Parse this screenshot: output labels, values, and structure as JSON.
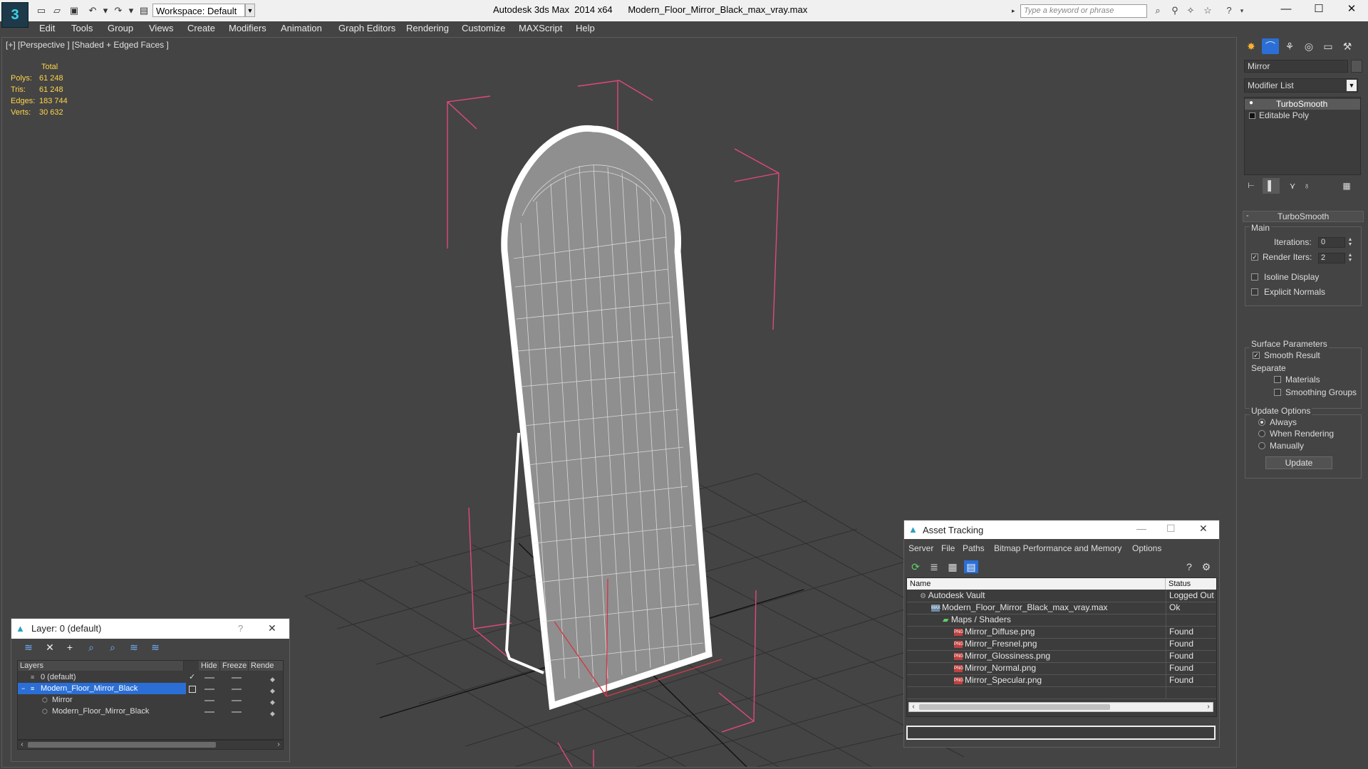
{
  "titlebar": {
    "app_title": "Autodesk 3ds Max  2014 x64",
    "file_title": "Modern_Floor_Mirror_Black_max_vray.max",
    "workspace": "Workspace: Default",
    "search_placeholder": "Type a keyword or phrase"
  },
  "menu": [
    "Edit",
    "Tools",
    "Group",
    "Views",
    "Create",
    "Modifiers",
    "Animation",
    "Graph Editors",
    "Rendering",
    "Customize",
    "MAXScript",
    "Help"
  ],
  "viewport": {
    "label": "[+] [Perspective ] [Shaded + Edged Faces ]",
    "stats": {
      "header": "Total",
      "polys_label": "Polys:",
      "polys": "61 248",
      "tris_label": "Tris:",
      "tris": "61 248",
      "edges_label": "Edges:",
      "edges": "183 744",
      "verts_label": "Verts:",
      "verts": "30 632"
    }
  },
  "command_panel": {
    "object_name": "Mirror",
    "modifier_list": "Modifier List",
    "stack": [
      "TurboSmooth",
      "Editable Poly"
    ],
    "rollout_title": "TurboSmooth",
    "main_label": "Main",
    "iterations_label": "Iterations:",
    "iterations": "0",
    "render_iters_label": "Render Iters:",
    "render_iters": "2",
    "render_iters_checked": true,
    "isoline_label": "Isoline Display",
    "explicit_normals_label": "Explicit Normals",
    "surface_label": "Surface Parameters",
    "smooth_result_label": "Smooth Result",
    "separate_label": "Separate",
    "materials_label": "Materials",
    "smoothing_groups_label": "Smoothing Groups",
    "update_options_label": "Update Options",
    "always_label": "Always",
    "when_rendering_label": "When Rendering",
    "manually_label": "Manually",
    "update_button": "Update"
  },
  "layer_dialog": {
    "title": "Layer: 0 (default)",
    "help": "?",
    "columns": [
      "Layers",
      "Hide",
      "Freeze",
      "Rende"
    ],
    "rows": [
      "0 (default)",
      "Modern_Floor_Mirror_Black",
      "Mirror",
      "Modern_Floor_Mirror_Black"
    ]
  },
  "asset_tracking": {
    "title": "Asset Tracking",
    "menu": [
      "Server",
      "File",
      "Paths",
      "Bitmap Performance and Memory",
      "Options"
    ],
    "columns": [
      "Name",
      "Status"
    ],
    "rows": [
      {
        "name": "Autodesk Vault",
        "status": "Logged Out"
      },
      {
        "name": "Modern_Floor_Mirror_Black_max_vray.max",
        "status": "Ok"
      },
      {
        "name": "Maps / Shaders",
        "status": ""
      },
      {
        "name": "Mirror_Diffuse.png",
        "status": "Found"
      },
      {
        "name": "Mirror_Fresnel.png",
        "status": "Found"
      },
      {
        "name": "Mirror_Glossiness.png",
        "status": "Found"
      },
      {
        "name": "Mirror_Normal.png",
        "status": "Found"
      },
      {
        "name": "Mirror_Specular.png",
        "status": "Found"
      }
    ]
  },
  "colors": {
    "stats_text": "#ffd54a",
    "selection": "#2b6fd6",
    "wire": "#ffffff",
    "bbox": "#e0497a"
  }
}
